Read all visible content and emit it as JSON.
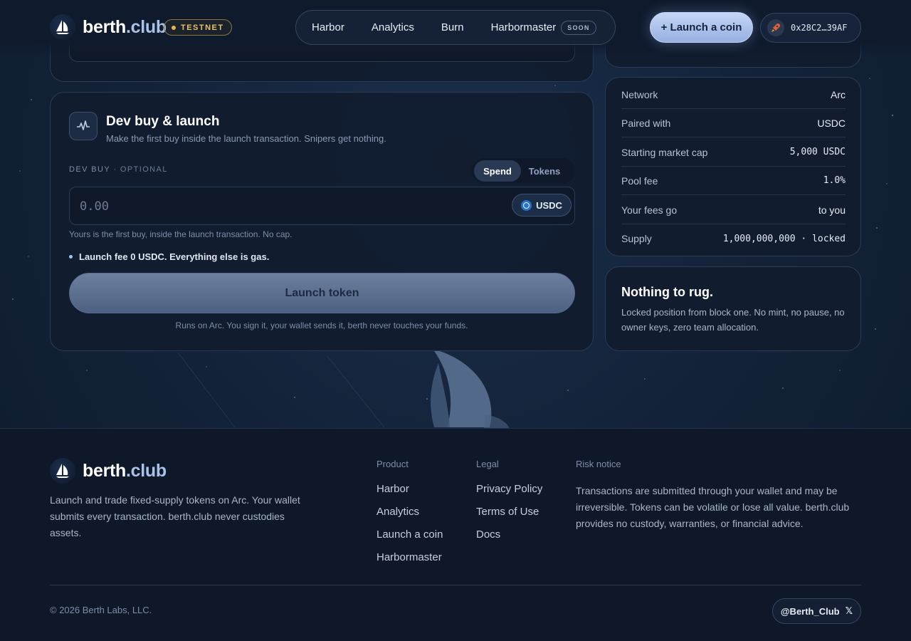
{
  "brand": {
    "name": "berth",
    "suffix": ".club",
    "badge": "TESTNET",
    "accent_color": "#a9c2ea",
    "badge_color": "#e8c16b",
    "logo_icon": "sailboat-icon"
  },
  "nav": {
    "items": [
      "Harbor",
      "Analytics",
      "Burn",
      "Harbormaster"
    ],
    "soon_badge": "SOON"
  },
  "header": {
    "launch_button": "+ Launch a coin",
    "wallet_address": "0x28C2…39AF",
    "wallet_avatar_icon": "rocket-icon"
  },
  "dev_buy": {
    "icon": "activity-pulse-icon",
    "title": "Dev buy & launch",
    "subtitle": "Make the first buy inside the launch transaction. Snipers get nothing.",
    "label": "DEV BUY",
    "label_separator": "·",
    "label_optional": "OPTIONAL",
    "toggle": [
      "Spend",
      "Tokens"
    ],
    "toggle_selected": "Spend",
    "amount_value": "0.00",
    "currency": "USDC",
    "currency_icon": "usdc-coin-icon",
    "help_text": "Yours is the first buy, inside the launch transaction. No cap.",
    "fee_text": "Launch fee 0 USDC. Everything else is gas.",
    "launch_button": "Launch token",
    "footnote": "Runs on Arc. You sign it, your wallet sends it, berth never touches your funds."
  },
  "details": [
    {
      "label": "Network",
      "value": "Arc"
    },
    {
      "label": "Paired with",
      "value": "USDC"
    },
    {
      "label": "Starting market cap",
      "value": "5,000 USDC"
    },
    {
      "label": "Pool fee",
      "value": "1.0%"
    },
    {
      "label": "Your fees go",
      "value": "to you"
    },
    {
      "label": "Supply",
      "value": "1,000,000,000 · locked"
    }
  ],
  "rug": {
    "title": "Nothing to rug.",
    "text": "Locked position from block one. No mint, no pause, no owner keys, zero team allocation."
  },
  "footer": {
    "description": "Launch and trade fixed-supply tokens on Arc. Your wallet submits every transaction. berth.club never custodies assets.",
    "product": {
      "heading": "Product",
      "links": [
        "Harbor",
        "Analytics",
        "Launch a coin",
        "Harbormaster"
      ]
    },
    "legal": {
      "heading": "Legal",
      "links": [
        "Privacy Policy",
        "Terms of Use",
        "Docs"
      ]
    },
    "risk": {
      "heading": "Risk notice",
      "text": "Transactions are submitted through your wallet and may be irreversible. Tokens can be volatile or lose all value. berth.club provides no custody, warranties, or financial advice."
    },
    "copyright": "© 2026 Berth Labs, LLC.",
    "social_handle": "@Berth_Club",
    "social_icon": "x-logo-icon"
  }
}
